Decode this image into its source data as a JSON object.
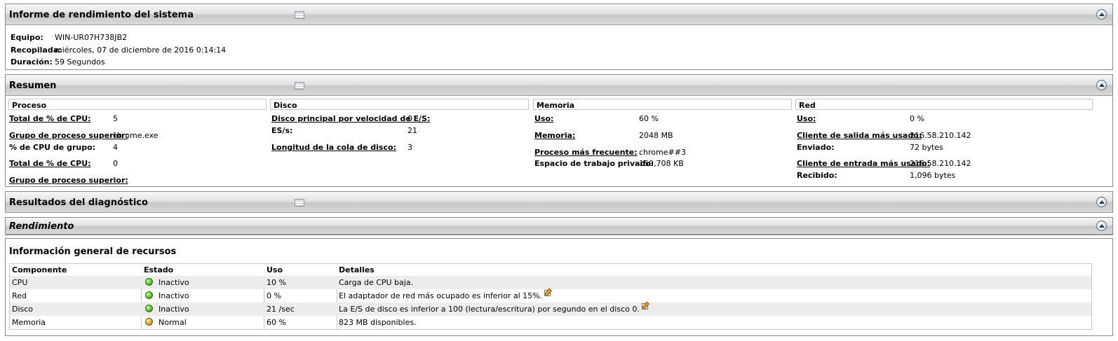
{
  "report": {
    "title": "Informe de rendimiento del sistema",
    "equipo_label": "Equipo:",
    "equipo_value": "WIN-UR07H738JB2",
    "recopilada_label": "Recopilada:",
    "recopilada_value": "miércoles, 07 de diciembre de 2016 0:14:14",
    "duracion_label": "Duración:",
    "duracion_value": "59 Segundos"
  },
  "summary": {
    "title": "Resumen",
    "proceso": {
      "header": "Proceso",
      "rows": [
        {
          "label": "Total de % de CPU:",
          "value": "5"
        },
        {
          "label": "Grupo de proceso superior:",
          "value": "chrome.exe"
        },
        {
          "label": "% de CPU de grupo:",
          "value": "4"
        },
        {
          "label": "Total de % de CPU:",
          "value": "0"
        },
        {
          "label": "Grupo de proceso superior:",
          "value": ""
        }
      ]
    },
    "disco": {
      "header": "Disco",
      "rows": [
        {
          "label": "Disco principal por velocidad de E/S:",
          "value": "0"
        },
        {
          "label": "ES/s:",
          "value": "21"
        },
        {
          "label": "Longitud de la cola de disco:",
          "value": "3"
        }
      ]
    },
    "memoria": {
      "header": "Memoria",
      "rows": [
        {
          "label": "Uso:",
          "value": "60 %"
        },
        {
          "label": "Memoria:",
          "value": "2048 MB"
        },
        {
          "label": "Proceso más frecuente:",
          "value": "chrome##3"
        },
        {
          "label": "Espacio de trabajo privado:",
          "value": "159,708 KB"
        }
      ]
    },
    "red": {
      "header": "Red",
      "rows": [
        {
          "label": "Uso:",
          "value": "0 %"
        },
        {
          "label": "Cliente de salida más usado:",
          "value": "216.58.210.142"
        },
        {
          "label": "Enviado:",
          "value": "72 bytes"
        },
        {
          "label": "Cliente de entrada más usado:",
          "value": "216.58.210.142"
        },
        {
          "label": "Recibido:",
          "value": "1,096 bytes"
        }
      ]
    }
  },
  "diagnostics": {
    "title": "Resultados del diagnóstico"
  },
  "performance": {
    "title": "Rendimiento"
  },
  "resources": {
    "title": "Información general de recursos",
    "columns": [
      "Componente",
      "Estado",
      "Uso",
      "Detalles"
    ],
    "rows": [
      {
        "component": "CPU",
        "state": "Inactivo",
        "status_color": "green",
        "usage": "10 %",
        "details": "Carga de CPU baja."
      },
      {
        "component": "Red",
        "state": "Inactivo",
        "status_color": "green",
        "usage": "0 %",
        "details": "El adaptador de red más ocupado es inferior al 15%."
      },
      {
        "component": "Disco",
        "state": "Inactivo",
        "status_color": "green",
        "usage": "21 /sec",
        "details": "La E/S de disco es inferior a 100 (lectura/escritura) por segundo en el disco 0."
      },
      {
        "component": "Memoria",
        "state": "Normal",
        "status_color": "yellow",
        "usage": "60 %",
        "details": "823 MB disponibles."
      }
    ]
  }
}
